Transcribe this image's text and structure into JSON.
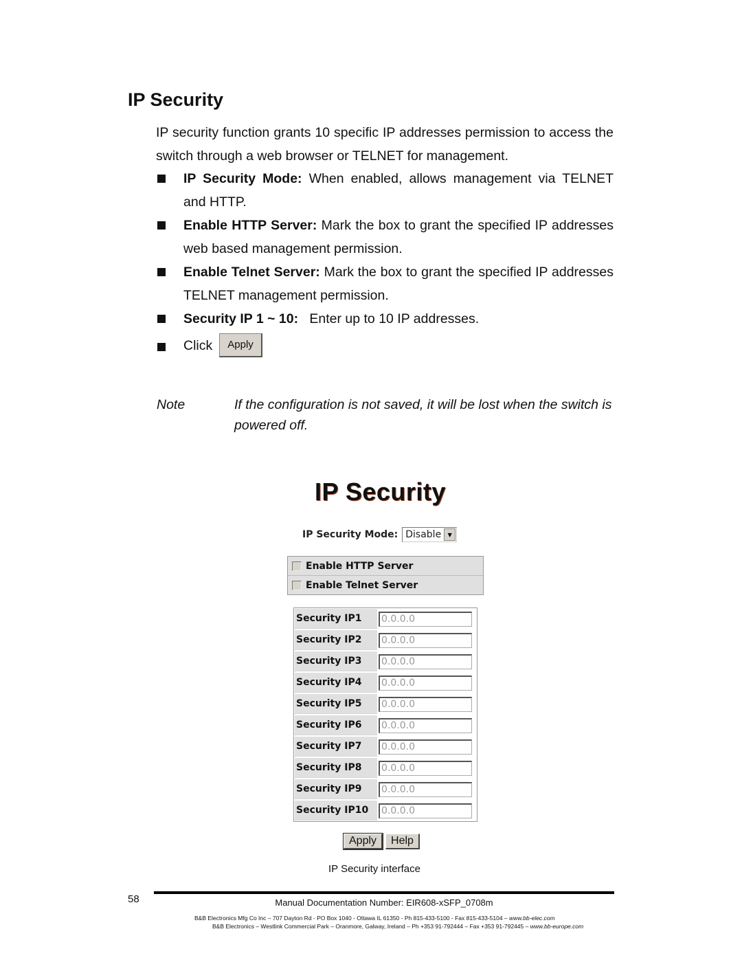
{
  "section": {
    "title": "IP Security",
    "intro": "IP security function grants 10 specific IP addresses permission to access the switch through a web browser or TELNET for management."
  },
  "bullets": [
    {
      "term": "IP Security Mode:",
      "text": " When enabled, allows management via TELNET and HTTP."
    },
    {
      "term": "Enable HTTP Server:",
      "text": " Mark the box to grant the specified IP addresses web based management permission."
    },
    {
      "term": "Enable Telnet Server:",
      "text": " Mark the box to grant the specified IP addresses TELNET management permission."
    },
    {
      "term": "Security IP 1 ~ 10:",
      "text": "   Enter up to 10 IP addresses."
    }
  ],
  "click_row": {
    "label": "Click",
    "button": "Apply"
  },
  "note": {
    "label": "Note",
    "text": "If the configuration is not saved, it will be lost when the switch is powered off."
  },
  "ui": {
    "title": "IP Security",
    "mode_label": "IP Security Mode:",
    "mode_value": "Disable",
    "checkboxes": [
      {
        "label": "Enable HTTP Server",
        "checked": false
      },
      {
        "label": "Enable Telnet Server",
        "checked": false
      }
    ],
    "security_ips": [
      {
        "label": "Security IP1",
        "value": "0.0.0.0"
      },
      {
        "label": "Security IP2",
        "value": "0.0.0.0"
      },
      {
        "label": "Security IP3",
        "value": "0.0.0.0"
      },
      {
        "label": "Security IP4",
        "value": "0.0.0.0"
      },
      {
        "label": "Security IP5",
        "value": "0.0.0.0"
      },
      {
        "label": "Security IP6",
        "value": "0.0.0.0"
      },
      {
        "label": "Security IP7",
        "value": "0.0.0.0"
      },
      {
        "label": "Security IP8",
        "value": "0.0.0.0"
      },
      {
        "label": "Security IP9",
        "value": "0.0.0.0"
      },
      {
        "label": "Security IP10",
        "value": "0.0.0.0"
      }
    ],
    "apply_label": "Apply",
    "help_label": "Help"
  },
  "caption": "IP Security interface",
  "footer": {
    "page_number": "58",
    "doc_number": "Manual Documentation Number: EIR608-xSFP_0708m",
    "line1_text": "B&B Electronics Mfg Co Inc – 707 Dayton Rd - PO Box 1040 - Ottawa IL 61350 - Ph 815-433-5100 - Fax 815-433-5104 – ",
    "line1_url": "www.bb-elec.com",
    "line2_text": "B&B Electronics – Westlink Commercial Park – Oranmore, Galway, Ireland – Ph +353 91-792444 – Fax +353 91-792445 – ",
    "line2_url": "www.bb-europe.com"
  }
}
